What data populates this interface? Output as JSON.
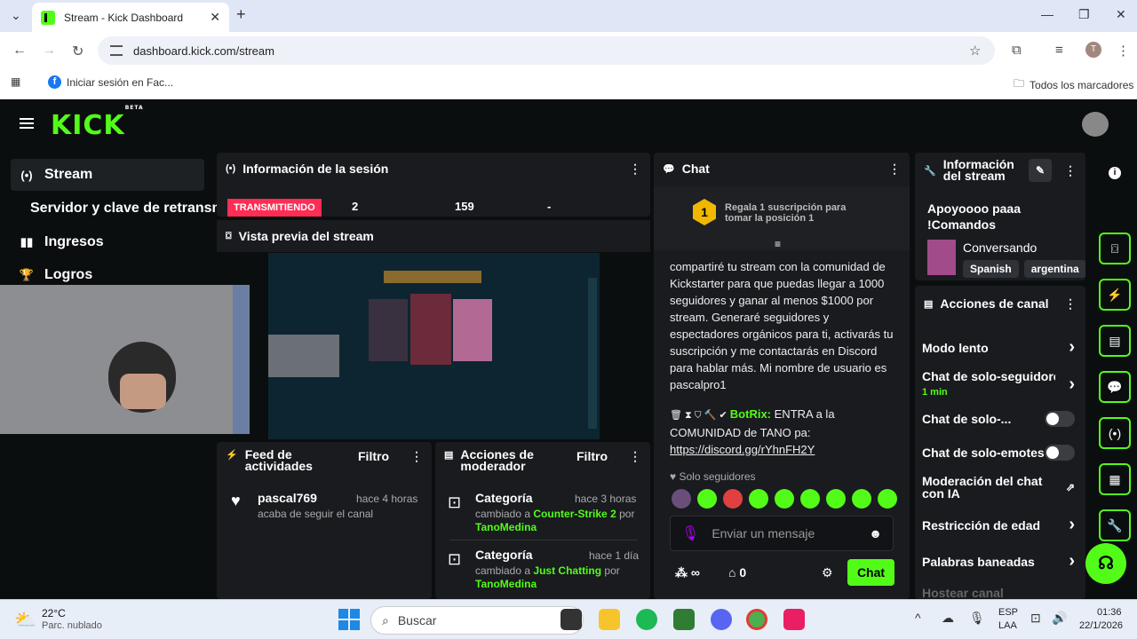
{
  "browser": {
    "tab_title": "Stream - Kick Dashboard",
    "url": "dashboard.kick.com/stream",
    "bookmark_fb": "Iniciar sesión en Fac...",
    "all_bookmarks": "Todos los marcadores",
    "profile_initial": "T"
  },
  "app": {
    "logo": "KICK",
    "logo_badge": "BETA"
  },
  "sidebar": {
    "items": [
      {
        "label": "Stream",
        "icon": "broadcast-icon"
      },
      {
        "label": "Servidor y clave de retransm"
      },
      {
        "label": "Ingresos",
        "icon": "bar-chart-icon"
      },
      {
        "label": "Logros",
        "icon": "trophy-icon"
      }
    ]
  },
  "session": {
    "title": "Información de la sesión",
    "status": "TRANSMITIENDO",
    "stat1": "2",
    "stat2": "159",
    "stat3": "-"
  },
  "preview": {
    "title": "Vista previa del stream"
  },
  "feed": {
    "title": "Feed de actividades",
    "filter": "Filtro",
    "user": "pascal769",
    "time": "hace 4 horas",
    "action": "acaba de seguir el canal"
  },
  "modactions": {
    "title": "Acciones de moderador",
    "filter": "Filtro",
    "items": [
      {
        "label": "Categoría",
        "time": "hace 3 horas",
        "prefix": "cambiado a",
        "category": "Counter-Strike 2",
        "by": "por",
        "user": "TanoMedina"
      },
      {
        "label": "Categoría",
        "time": "hace 1 día",
        "prefix": "cambiado a",
        "category": "Just Chatting",
        "by": "por",
        "user": "TanoMedina"
      }
    ]
  },
  "chat": {
    "title": "Chat",
    "gift_text": "Regala 1 suscripción para tomar la posición 1",
    "gift_rank": "1",
    "message": "compartiré tu stream con la comunidad de Kickstarter para que puedas llegar a 1000 seguidores y ganar al menos $1000 por stream. Generaré seguidores y espectadores orgánicos para ti, activarás tu suscripción y me contactarás en Discord para hablar más. Mi nombre de usuario es pascalpro1",
    "bot_name": "BotRix:",
    "bot_text": "ENTRA a la COMUNIDAD de TANO pa:",
    "bot_link": "https://discord.gg/rYhnFH2Y",
    "followers_only": "Solo seguidores",
    "placeholder": "Enviar un mensaje",
    "points": "0",
    "send": "Chat"
  },
  "streaminfo": {
    "title": "Información del stream",
    "stream_title": "Apoyoooo paaa !Comandos",
    "category": "Conversando",
    "tags": [
      "Spanish",
      "argentina"
    ]
  },
  "channel_actions": {
    "title": "Acciones de canal",
    "slow_mode": "Modo lento",
    "followers_only": "Chat de solo-seguidores",
    "followers_time": "1 min",
    "subs_only": "Chat de solo-...",
    "emotes_only": "Chat de solo-emotes",
    "ai_mod": "Moderación del chat con IA",
    "age": "Restricción de edad",
    "banned": "Palabras baneadas",
    "host": "Hostear canal"
  },
  "taskbar": {
    "temp": "22°C",
    "weather": "Parc. nublado",
    "search": "Buscar",
    "lang1": "ESP",
    "lang2": "LAA",
    "time": "01:36",
    "date": "22/1/2026"
  }
}
